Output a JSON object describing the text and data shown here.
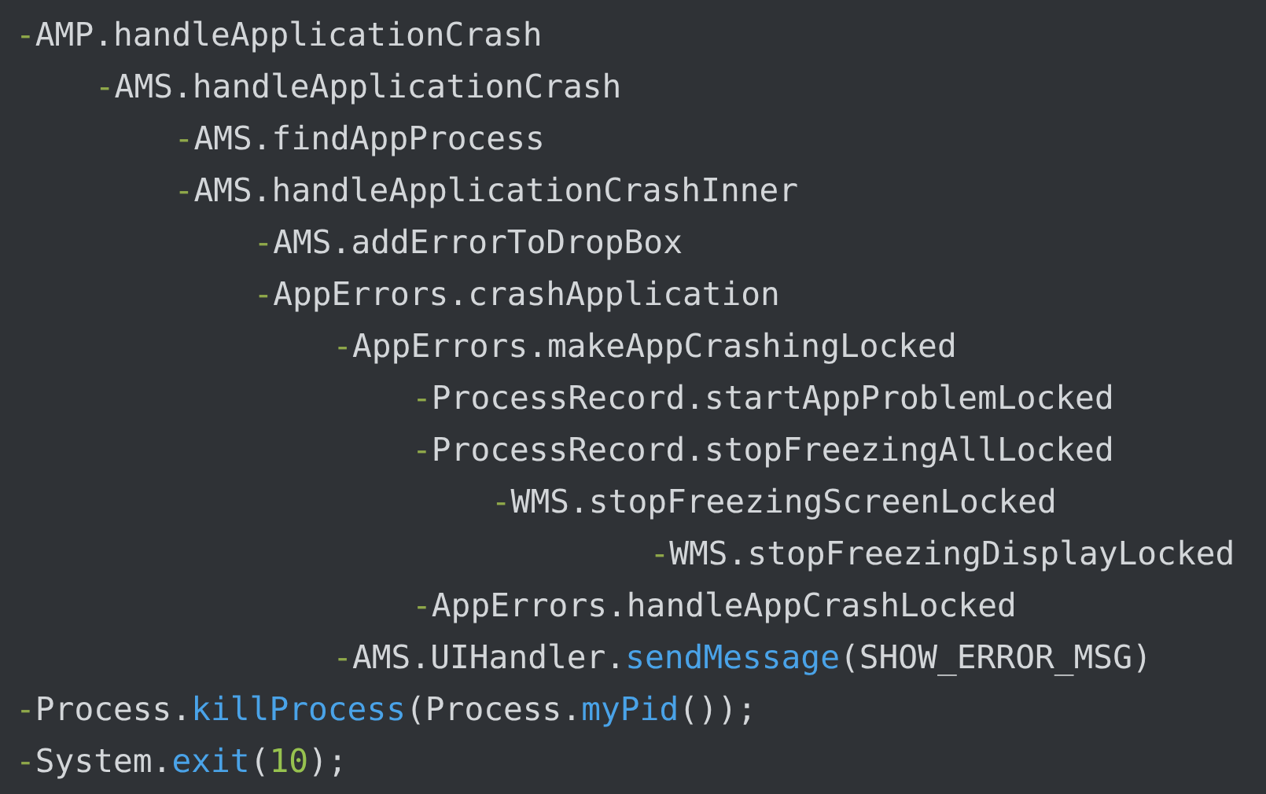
{
  "code_tree": [
    {
      "marker": "-",
      "kind": "call",
      "text": "AMP.handleApplicationCrash",
      "children": [
        {
          "marker": "-",
          "kind": "call",
          "text": "AMS.handleApplicationCrash",
          "children": [
            {
              "marker": "-",
              "kind": "call",
              "text": "AMS.findAppProcess"
            },
            {
              "marker": "-",
              "kind": "call",
              "text": "AMS.handleApplicationCrashInner",
              "children": [
                {
                  "marker": "-",
                  "kind": "call",
                  "text": "AMS.addErrorToDropBox"
                },
                {
                  "marker": "-",
                  "kind": "call",
                  "text": "AppErrors.crashApplication",
                  "children": [
                    {
                      "marker": "-",
                      "kind": "call",
                      "text": "AppErrors.makeAppCrashingLocked",
                      "children": [
                        {
                          "marker": "-",
                          "kind": "call",
                          "text": "ProcessRecord.startAppProblemLocked"
                        },
                        {
                          "marker": "-",
                          "kind": "call",
                          "text": "ProcessRecord.stopFreezingAllLocked",
                          "children": [
                            {
                              "marker": "-",
                              "kind": "deep-call",
                              "text": "WMS.stopFreezingScreenLocked",
                              "children": [
                                {
                                  "marker": "-",
                                  "kind": "call",
                                  "text": "WMS.stopFreezingDisplayLocked"
                                }
                              ]
                            }
                          ]
                        },
                        {
                          "marker": "-",
                          "kind": "call",
                          "text": "AppErrors.handleAppCrashLocked"
                        }
                      ]
                    },
                    {
                      "marker": "-",
                      "kind": "call",
                      "tokens": [
                        {
                          "kind": "plain",
                          "text": "AMS.UIHandler."
                        },
                        {
                          "kind": "method",
                          "text": "sendMessage"
                        },
                        {
                          "kind": "plain",
                          "text": "(SHOW_ERROR_MSG)"
                        }
                      ]
                    }
                  ]
                }
              ]
            }
          ]
        }
      ]
    },
    {
      "marker": "-",
      "kind": "call",
      "tokens": [
        {
          "kind": "plain",
          "text": "Process."
        },
        {
          "kind": "method",
          "text": "killProcess"
        },
        {
          "kind": "plain",
          "text": "(Process."
        },
        {
          "kind": "method",
          "text": "myPid"
        },
        {
          "kind": "plain",
          "text": "());"
        }
      ]
    },
    {
      "marker": "-",
      "kind": "call",
      "tokens": [
        {
          "kind": "plain",
          "text": "System."
        },
        {
          "kind": "method",
          "text": "exit"
        },
        {
          "kind": "plain",
          "text": "("
        },
        {
          "kind": "number",
          "text": "10"
        },
        {
          "kind": "plain",
          "text": ");"
        }
      ]
    }
  ]
}
